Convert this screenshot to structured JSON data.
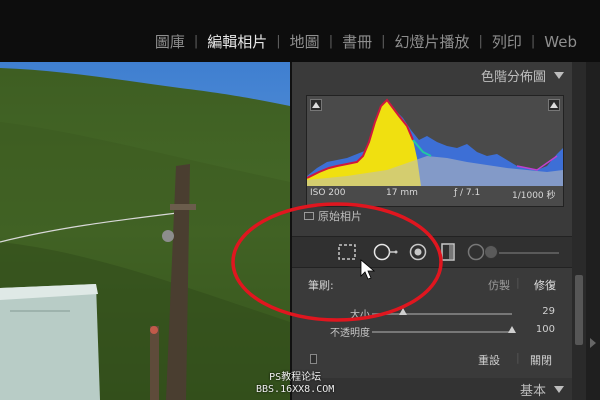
{
  "modules": {
    "items": [
      "圖庫",
      "編輯相片",
      "地圖",
      "書冊",
      "幻燈片播放",
      "列印",
      "Web"
    ],
    "active": "編輯相片"
  },
  "histogram": {
    "title": "色階分佈圖",
    "iso": "ISO 200",
    "focal": "17 mm",
    "aperture": "ƒ / 7.1",
    "shutter": "1/1000 秒",
    "original_photo_label": "原始相片"
  },
  "tools": {
    "icons": [
      "crop-overlay-icon",
      "spot-removal-icon",
      "red-eye-icon",
      "graduated-filter-icon",
      "adjustment-brush-icon"
    ]
  },
  "brush": {
    "label": "筆刷:",
    "mode_clone": "仿製",
    "mode_heal": "修復",
    "size_label": "大小",
    "size_value": "29",
    "size_fraction": 0.22,
    "opacity_label": "不透明度",
    "opacity_value": "100",
    "opacity_fraction": 1.0
  },
  "actions": {
    "reset": "重設",
    "close": "關閉"
  },
  "basic_panel": {
    "title": "基本"
  },
  "watermark": {
    "line1": "PS教程论坛",
    "line2": "BBS.16XX8.COM"
  },
  "colors": {
    "annotation": "#e0161f",
    "panel": "#3a3a3a",
    "histogram_yellow": "#f0e010",
    "histogram_blue": "#3d6fd6"
  }
}
